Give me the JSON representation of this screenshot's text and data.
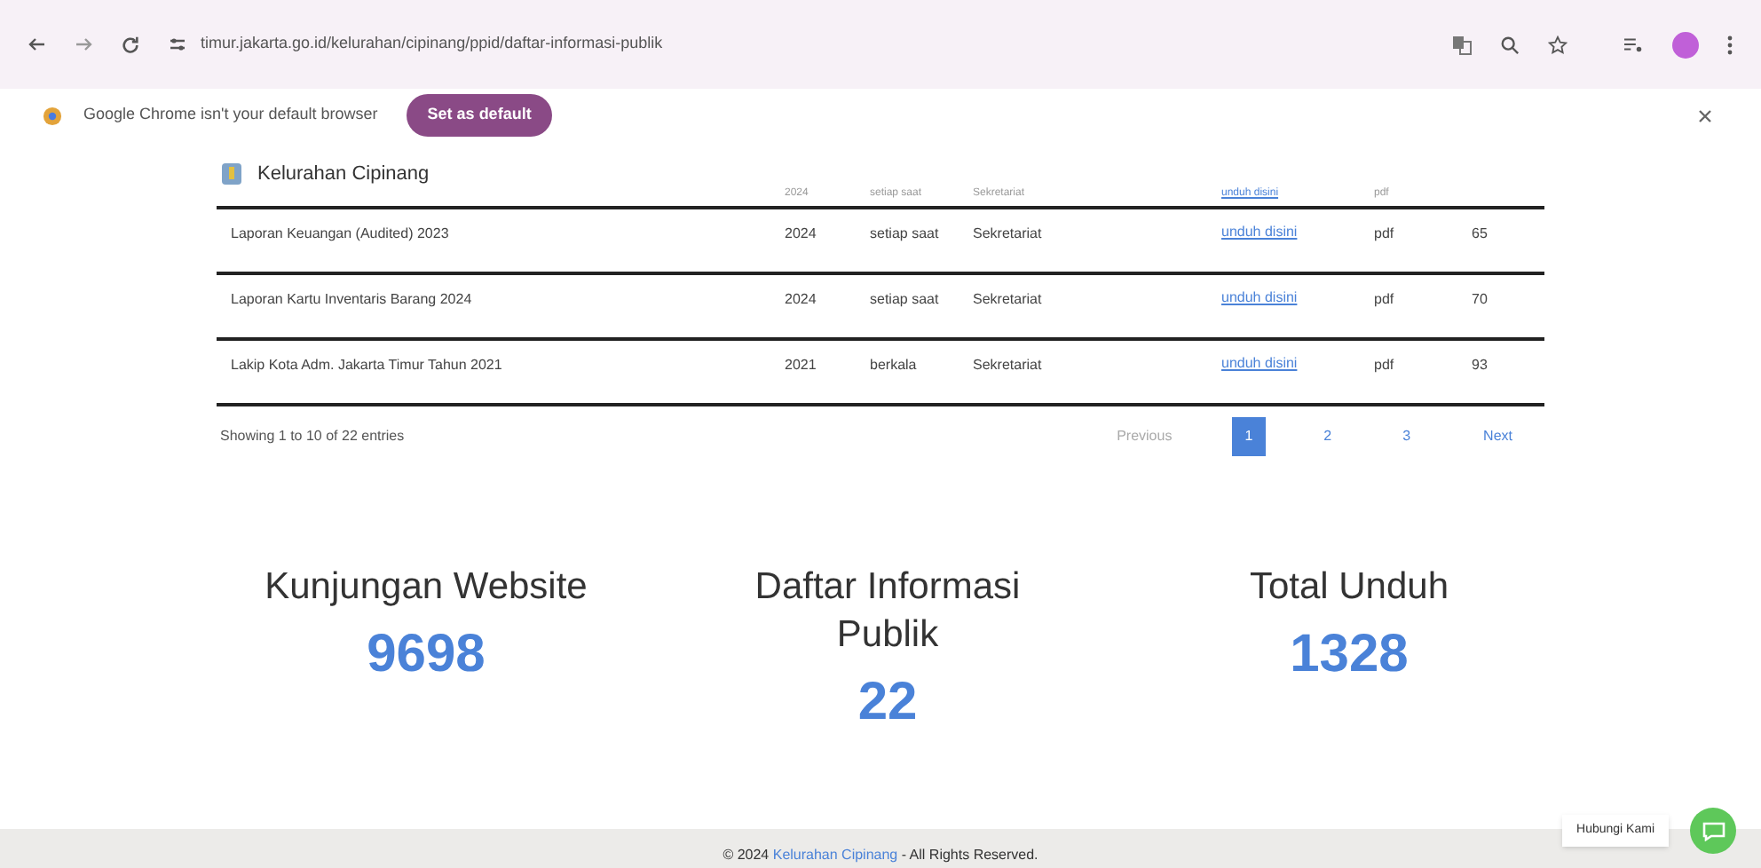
{
  "browser": {
    "url": "timur.jakarta.go.id/kelurahan/cipinang/ppid/daftar-informasi-publik",
    "infobar_message": "Google Chrome isn't your default browser",
    "infobar_button": "Set as default"
  },
  "site": {
    "title": "Kelurahan Cipinang"
  },
  "table": {
    "rows": [
      {
        "cells": [
          "",
          "2024",
          "setiap saat",
          "Sekretariat",
          "unduh disini",
          "pdf",
          ""
        ],
        "partial": true
      },
      {
        "cells": [
          "Laporan Keuangan (Audited) 2023",
          "2024",
          "setiap saat",
          "Sekretariat",
          "unduh disini",
          "pdf",
          "65"
        ],
        "partial": false
      },
      {
        "cells": [
          "Laporan Kartu Inventaris Barang 2024",
          "2024",
          "setiap saat",
          "Sekretariat",
          "unduh disini",
          "pdf",
          "70"
        ],
        "partial": false
      },
      {
        "cells": [
          "Lakip Kota Adm. Jakarta Timur Tahun 2021",
          "2021",
          "berkala",
          "Sekretariat",
          "unduh disini",
          "pdf",
          "93"
        ],
        "partial": false
      }
    ],
    "info": "Showing 1 to 10 of 22 entries"
  },
  "pagination": {
    "previous": "Previous",
    "pages": [
      {
        "label": "1",
        "selected": true
      },
      {
        "label": "2",
        "selected": false
      },
      {
        "label": "3",
        "selected": false
      }
    ],
    "next": "Next"
  },
  "stats": [
    {
      "label": "Kunjungan Website",
      "value": "9698"
    },
    {
      "label": "Daftar Informasi Publik",
      "value": "22"
    },
    {
      "label": "Total Unduh",
      "value": "1328"
    }
  ],
  "footer": {
    "prefix": "© 2024",
    "link": "Kelurahan Cipinang",
    "suffix": "- All Rights Reserved."
  },
  "chat": {
    "label": "Hubungi Kami"
  }
}
